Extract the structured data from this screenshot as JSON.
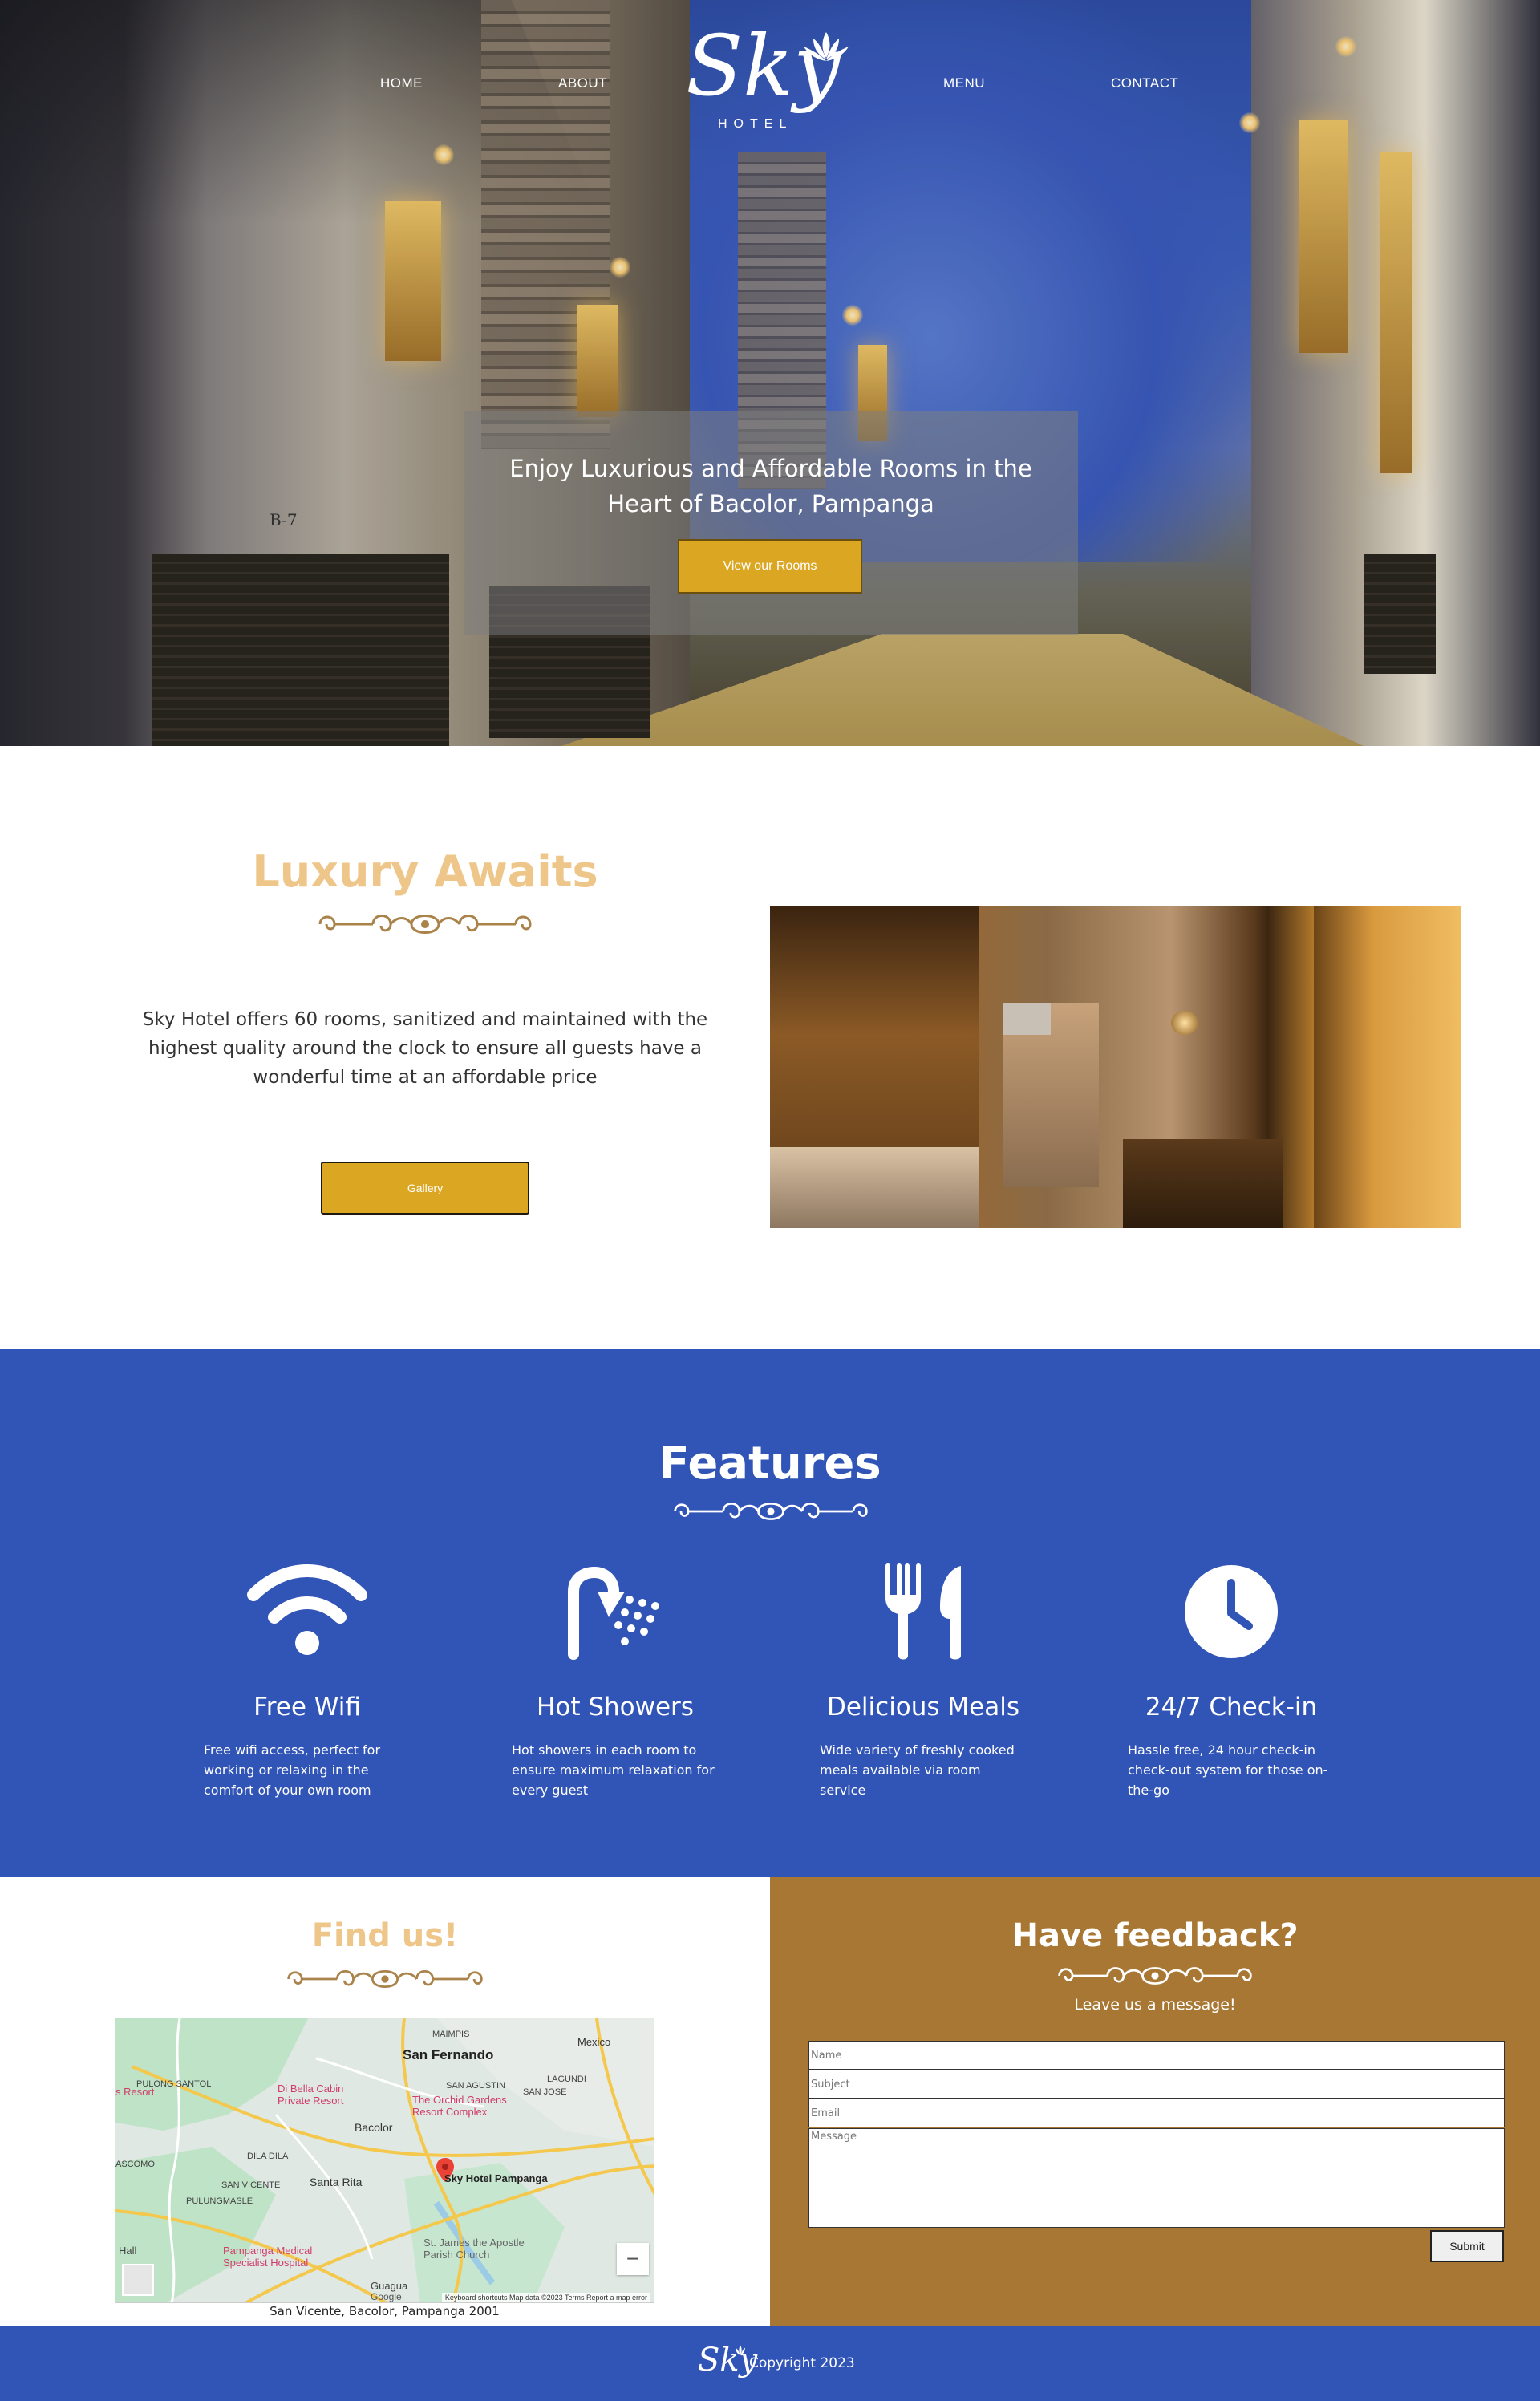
{
  "nav": {
    "items": [
      {
        "label": "HOME"
      },
      {
        "label": "ABOUT"
      },
      {
        "label": "MENU"
      },
      {
        "label": "CONTACT"
      }
    ],
    "logo_word": "Sky",
    "logo_sub": "HOTEL"
  },
  "hero": {
    "headline_line1": "Enjoy Luxurious and Affordable Rooms in the",
    "headline_line2": "Heart of Bacolor, Pampanga",
    "button_label": "View our Rooms",
    "door_label": "B-7"
  },
  "luxury": {
    "title": "Luxury Awaits",
    "description": "Sky Hotel offers 60 rooms, sanitized and maintained with the highest quality around the clock to ensure all guests have a wonderful time at an affordable price",
    "button_label": "Gallery"
  },
  "features": {
    "title": "Features",
    "items": [
      {
        "name": "Free Wifi",
        "icon": "wifi-icon",
        "description": "Free wifi access, perfect for working or relaxing in the comfort of your own room"
      },
      {
        "name": "Hot Showers",
        "icon": "shower-icon",
        "description": "Hot showers in each room to ensure maximum relaxation for every guest"
      },
      {
        "name": "Delicious Meals",
        "icon": "utensils-icon",
        "description": "Wide variety of freshly cooked meals available via room service"
      },
      {
        "name": "24/7 Check-in",
        "icon": "clock-icon",
        "description": "Hassle free, 24 hour check-in check-out system for those on-the-go"
      }
    ]
  },
  "find_us": {
    "title": "Find us!",
    "address": "San Vicente, Bacolor, Pampanga 2001",
    "map": {
      "places": {
        "san_fernando": "San Fernando",
        "mexico": "Mexico",
        "maimpis": "MAIMPIS",
        "pulong_santol": "PULONG SANTOL",
        "san_agustin": "SAN AGUSTIN",
        "lagundi": "LAGUNDI",
        "san_jose": "SAN JOSE",
        "bacolor": "Bacolor",
        "dila_dila": "DILA DILA",
        "ascomo": "ASCOMO",
        "san_vicente": "SAN VICENTE",
        "santa_rita": "Santa Rita",
        "pulungmasle": "PULUNGMASLE",
        "resort": "s Resort",
        "hall": "Hall",
        "gabaua": "Guagua"
      },
      "pois": {
        "dibella": "Di Bella Cabin Private Resort",
        "orchid": "The Orchid Gardens Resort Complex",
        "hotel": "Sky Hotel Pampanga",
        "hospital": "Pampanga Medical Specialist Hospital",
        "church": "St. James the Apostle Parish Church"
      },
      "zoom_out": "−",
      "footer": "Keyboard shortcuts   Map data ©2023   Terms   Report a map error",
      "google": "Google"
    }
  },
  "feedback": {
    "title": "Have feedback?",
    "subtitle": "Leave us a message!",
    "name_placeholder": "Name",
    "subject_placeholder": "Subject",
    "email_placeholder": "Email",
    "message_placeholder": "Message",
    "submit_label": "Submit"
  },
  "footer": {
    "logo_word": "Sky",
    "copyright": "Copyright 2023"
  },
  "colors": {
    "gold_button": "#dba622",
    "title_gold": "#eec68a",
    "blue": "#3154b7",
    "brown": "#a97734"
  }
}
